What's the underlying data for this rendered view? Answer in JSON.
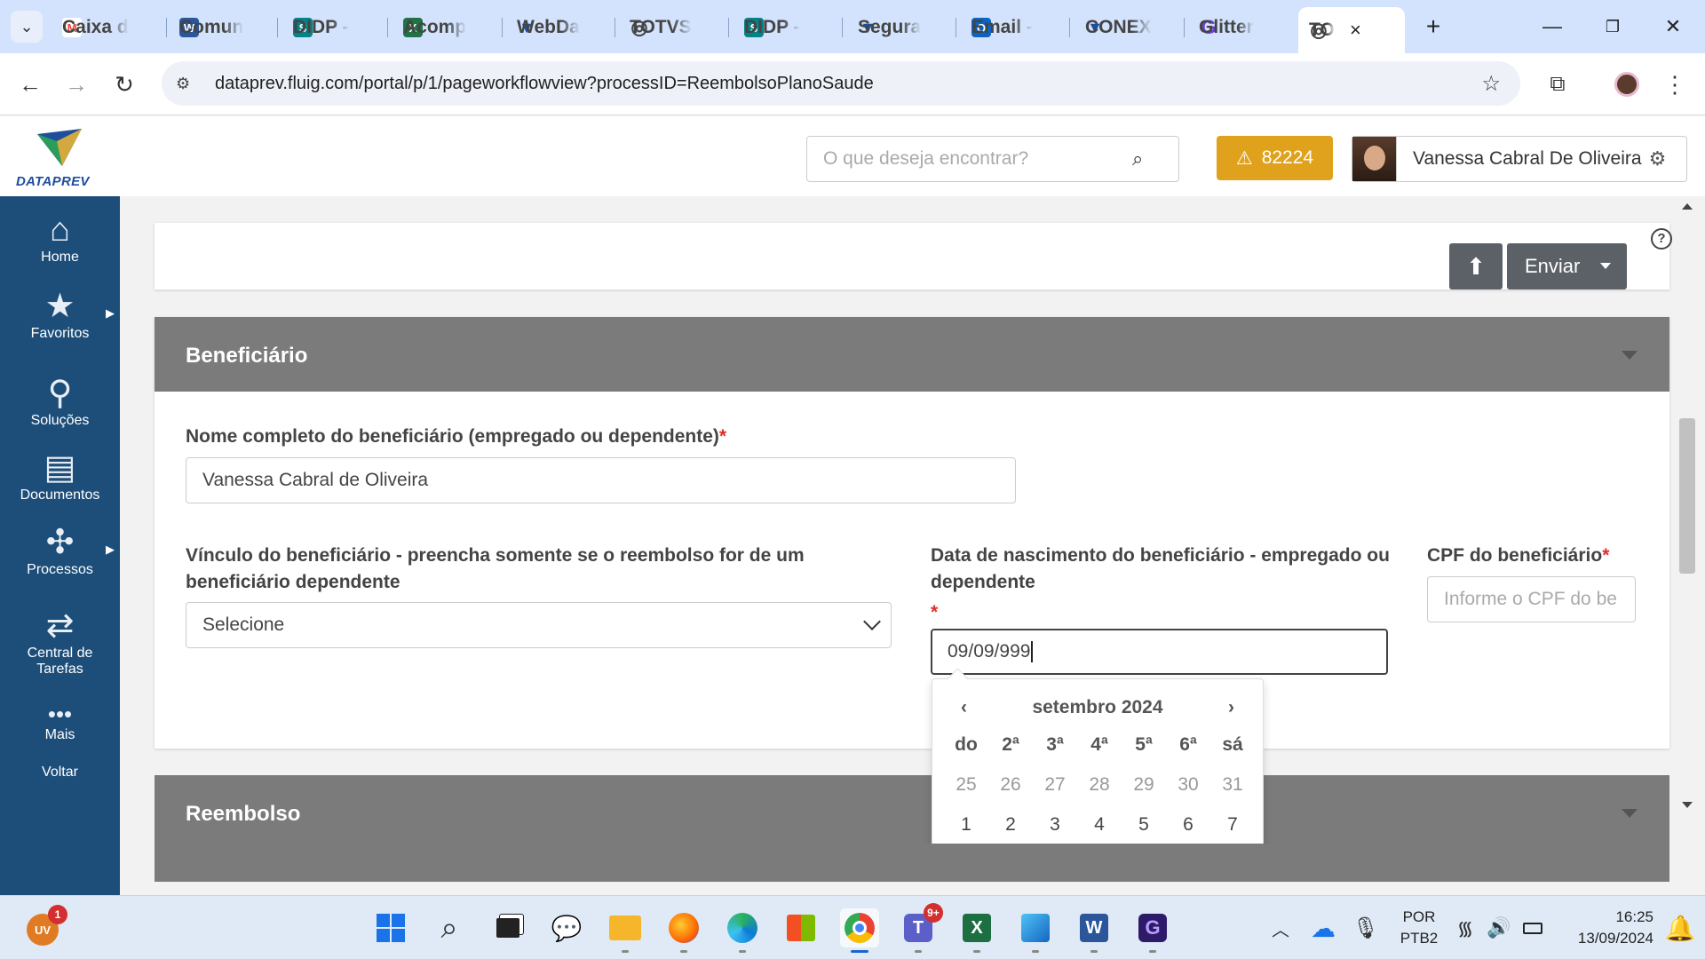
{
  "browser": {
    "tabs": [
      {
        "label": "Caixa d",
        "favicon": "gmail-icon",
        "color": "#ea4335",
        "glyph": "M"
      },
      {
        "label": "Comun",
        "favicon": "word-icon",
        "color": "#2b579a",
        "glyph": "W"
      },
      {
        "label": "DIDP -",
        "favicon": "sharepoint-icon",
        "color": "#038387",
        "glyph": "S"
      },
      {
        "label": "Acomp",
        "favicon": "excel-icon",
        "color": "#217346",
        "glyph": "X"
      },
      {
        "label": "WebDa",
        "favicon": "dataprev-icon",
        "color": "#1d4f9c",
        "glyph": "▼"
      },
      {
        "label": "TOTVS",
        "favicon": "totvs-icon",
        "color": "#444444",
        "glyph": "◎"
      },
      {
        "label": "DIDP -",
        "favicon": "sharepoint-icon",
        "color": "#038387",
        "glyph": "S"
      },
      {
        "label": "Segura",
        "favicon": "dataprev-icon",
        "color": "#1d4f9c",
        "glyph": "▼"
      },
      {
        "label": "Email -",
        "favicon": "outlook-icon",
        "color": "#0a64c4",
        "glyph": "O"
      },
      {
        "label": "CONEX",
        "favicon": "dataprev-icon",
        "color": "#1d4f9c",
        "glyph": "▼"
      },
      {
        "label": "Glitter",
        "favicon": "glitter-icon",
        "color": "#6c3fd1",
        "glyph": "G"
      },
      {
        "label": "TO",
        "favicon": "totvs-icon",
        "color": "#444444",
        "glyph": "◎",
        "active": true
      }
    ],
    "url": "dataprev.fluig.com/portal/p/1/pageworkflowview?processID=ReembolsoPlanoSaude"
  },
  "header": {
    "logo_text": "DATAPREV",
    "search_placeholder": "O que deseja encontrar?",
    "alert_count": "82224",
    "user_name": "Vanessa Cabral De Oliveira"
  },
  "sidebar": {
    "items": [
      {
        "label": "Home",
        "icon": "home-icon"
      },
      {
        "label": "Favoritos",
        "icon": "star-icon",
        "has_arrow": true
      },
      {
        "label": "Soluções",
        "icon": "rocket-icon"
      },
      {
        "label": "Documentos",
        "icon": "documents-icon"
      },
      {
        "label": "Processos",
        "icon": "process-icon",
        "has_arrow": true
      },
      {
        "label": "Central de Tarefas",
        "icon": "tasks-icon"
      },
      {
        "label": "Mais",
        "icon": "more-icon"
      },
      {
        "label": "Voltar",
        "icon": ""
      }
    ]
  },
  "actions": {
    "send_label": "Enviar"
  },
  "beneficiario": {
    "title": "Beneficiário",
    "nome_label": "Nome completo do beneficiário (empregado ou dependente)",
    "nome_value": "Vanessa Cabral de Oliveira",
    "vinculo_label": "Vínculo do beneficiário - preencha somente se o reembolso for de um beneficiário dependente",
    "vinculo_value": "Selecione",
    "nasc_label": "Data de nascimento do beneficiário - empregado ou dependente",
    "nasc_value": "09/09/999",
    "cpf_label": "CPF do beneficiário",
    "cpf_placeholder": "Informe o CPF do be",
    "required_mark": "*"
  },
  "datepicker": {
    "month_label": "setembro 2024",
    "prev": "‹",
    "next": "›",
    "weekdays": [
      "do",
      "2ª",
      "3ª",
      "4ª",
      "5ª",
      "6ª",
      "sá"
    ],
    "week1": [
      "25",
      "26",
      "27",
      "28",
      "29",
      "30",
      "31"
    ],
    "week2": [
      "1",
      "2",
      "3",
      "4",
      "5",
      "6",
      "7"
    ]
  },
  "reembolso": {
    "title": "Reembolso"
  },
  "taskbar": {
    "user_badge": "1",
    "teams_badge": "9+",
    "lang_line1": "POR",
    "lang_line2": "PTB2",
    "time": "16:25",
    "date": "13/09/2024"
  }
}
